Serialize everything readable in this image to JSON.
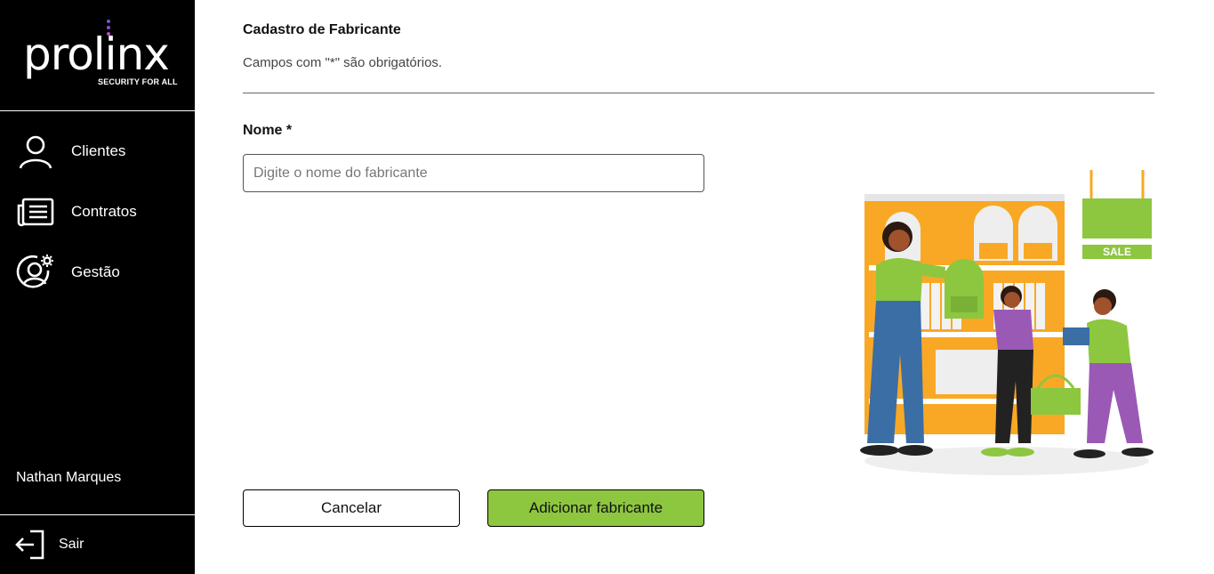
{
  "brand": {
    "logo_text": "prolinx",
    "tagline": "SECURITY FOR ALL",
    "dot_colors": [
      "#6a5acd",
      "#8a4fc9",
      "#b04fc0",
      "#d25aa8"
    ],
    "accent": "#8dc63f"
  },
  "sidebar": {
    "items": [
      {
        "label": "Clientes",
        "icon": "user-icon"
      },
      {
        "label": "Contratos",
        "icon": "document-list-icon"
      },
      {
        "label": "Gestão",
        "icon": "user-settings-icon"
      }
    ],
    "user_name": "Nathan Marques",
    "logout_label": "Sair",
    "logout_icon": "logout-icon"
  },
  "main": {
    "title": "Cadastro de Fabricante",
    "subtitle": "Campos com \"*\" são obrigatórios.",
    "form": {
      "name_label": "Nome *",
      "name_value": "",
      "name_placeholder": "Digite o nome do fabricante"
    },
    "buttons": {
      "cancel": "Cancelar",
      "submit": "Adicionar fabricante"
    },
    "illustration": {
      "sign_text": "SALE",
      "colors": {
        "shelf": "#f9a825",
        "green": "#8dc63f",
        "blue": "#3b6ea5",
        "purple": "#9b59b6"
      }
    }
  }
}
